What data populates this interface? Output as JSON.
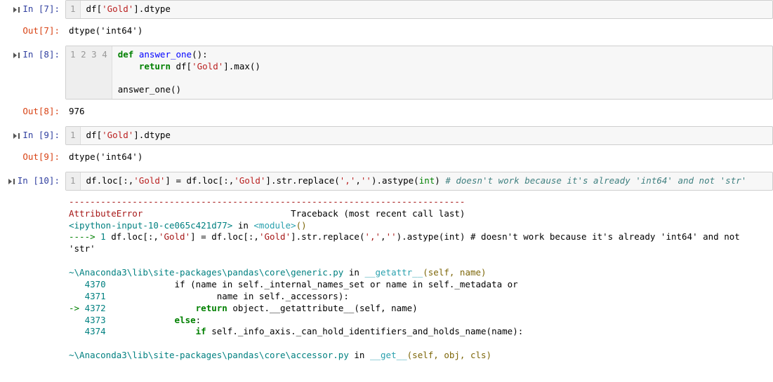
{
  "cells": {
    "c7": {
      "in_label": "In [7]:",
      "out_label": "Out[7]:",
      "gutter": "1",
      "out": "dtype('int64')"
    },
    "c8": {
      "in_label": "In [8]:",
      "out_label": "Out[8]:",
      "g1": "1",
      "g2": "2",
      "g3": "3",
      "g4": "4",
      "out": "976"
    },
    "c9": {
      "in_label": "In [9]:",
      "out_label": "Out[9]:",
      "gutter": "1",
      "out": "dtype('int64')"
    },
    "c10": {
      "in_label": "In [10]:",
      "gutter": "1"
    }
  },
  "code": {
    "c7": {
      "t1": "df[",
      "s1": "'Gold'",
      "t2": "].dtype"
    },
    "c8": {
      "l1_k": "def",
      "l1_sp": " ",
      "l1_fn": "answer_one",
      "l1_t": "():",
      "l2_pad": "    ",
      "l2_k": "return",
      "l2_t1": " df[",
      "l2_s": "'Gold'",
      "l2_t2": "].max()",
      "l4": "answer_one()"
    },
    "c9": {
      "t1": "df[",
      "s1": "'Gold'",
      "t2": "].dtype"
    },
    "c10": {
      "t1": "df.loc[:,",
      "s1": "'Gold'",
      "t2": "] = df.loc[:,",
      "s2": "'Gold'",
      "t3": "].str.replace(",
      "s3": "','",
      "t4": ",",
      "s4": "''",
      "t5": ").astype(",
      "nb": "int",
      "t6": ") ",
      "c": "# doesn't work because it's already 'int64' and not 'str'"
    }
  },
  "tb": {
    "dash": "---------------------------------------------------------------------------",
    "errname": "AttributeError",
    "errpad": "                            ",
    "errtail": "Traceback (most recent call last)",
    "frame1a": "<ipython-input-10-ce065c421d77>",
    "frame1b": " in ",
    "frame1c": "<module>",
    "frame1d": "()",
    "arrow": "----> ",
    "one": "1",
    "l1a": " df.loc[:,",
    "l1s1": "'Gold'",
    "l1b": "] = df.loc[:,",
    "l1s2": "'Gold'",
    "l1c": "].str.replace(",
    "l1s3": "','",
    "l1d": ",",
    "l1s4": "''",
    "l1e": ").astype(int) ",
    "l1f": "# doesn't work because it's already 'int64' and not 'str'",
    "frame2a": "~\\Anaconda3\\lib\\site-packages\\pandas\\core\\generic.py",
    "frame2b": " in ",
    "frame2c": "__getattr__",
    "frame2d": "(self, name)",
    "g4370": "   4370 ",
    "t4370": "            if (name in self._internal_names_set or name in self._metadata or",
    "g4371": "   4371 ",
    "t4371": "                    name in self._accessors):",
    "arr4372": "-> ",
    "g4372": "4372 ",
    "t4372a": "                ",
    "t4372k": "return",
    "t4372b": " object.__getattribute__(self, name)",
    "g4373": "   4373 ",
    "t4373a": "            ",
    "t4373k": "else",
    "t4373b": ":",
    "g4374": "   4374 ",
    "t4374a": "                ",
    "t4374k": "if",
    "t4374b": " self._info_axis._can_hold_identifiers_and_holds_name(name):",
    "frame3a": "~\\Anaconda3\\lib\\site-packages\\pandas\\core\\accessor.py",
    "frame3b": " in ",
    "frame3c": "__get__",
    "frame3d": "(self, obj, cls)"
  }
}
